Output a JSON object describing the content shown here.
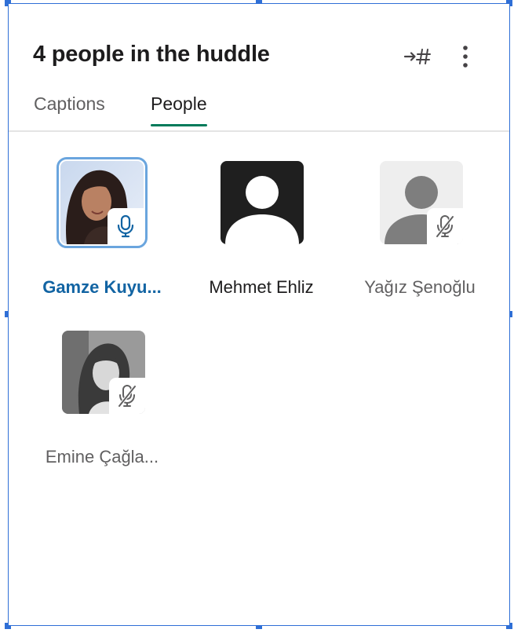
{
  "header": {
    "title": "4 people in the huddle",
    "move_icon": "arrow-to-channel-icon",
    "more_icon": "vertical-ellipsis-icon"
  },
  "tabs": [
    {
      "label": "Captions",
      "selected": false
    },
    {
      "label": "People",
      "selected": true
    }
  ],
  "people": [
    {
      "name": "Gamze Kuyu...",
      "mic": "on",
      "speaking": true,
      "avatar": "photo"
    },
    {
      "name": "Mehmet Ehliz",
      "mic": "none",
      "speaking": false,
      "avatar": "default-dark"
    },
    {
      "name": "Yağız Şenoğlu",
      "mic": "muted",
      "speaking": false,
      "avatar": "default-grey"
    },
    {
      "name": "Emine Çağla...",
      "mic": "muted",
      "speaking": false,
      "avatar": "photo-grey"
    }
  ],
  "colors": {
    "accent_tab": "#007a5a",
    "active_name": "#1264a3",
    "speaking_ring": "#6aa5de"
  }
}
